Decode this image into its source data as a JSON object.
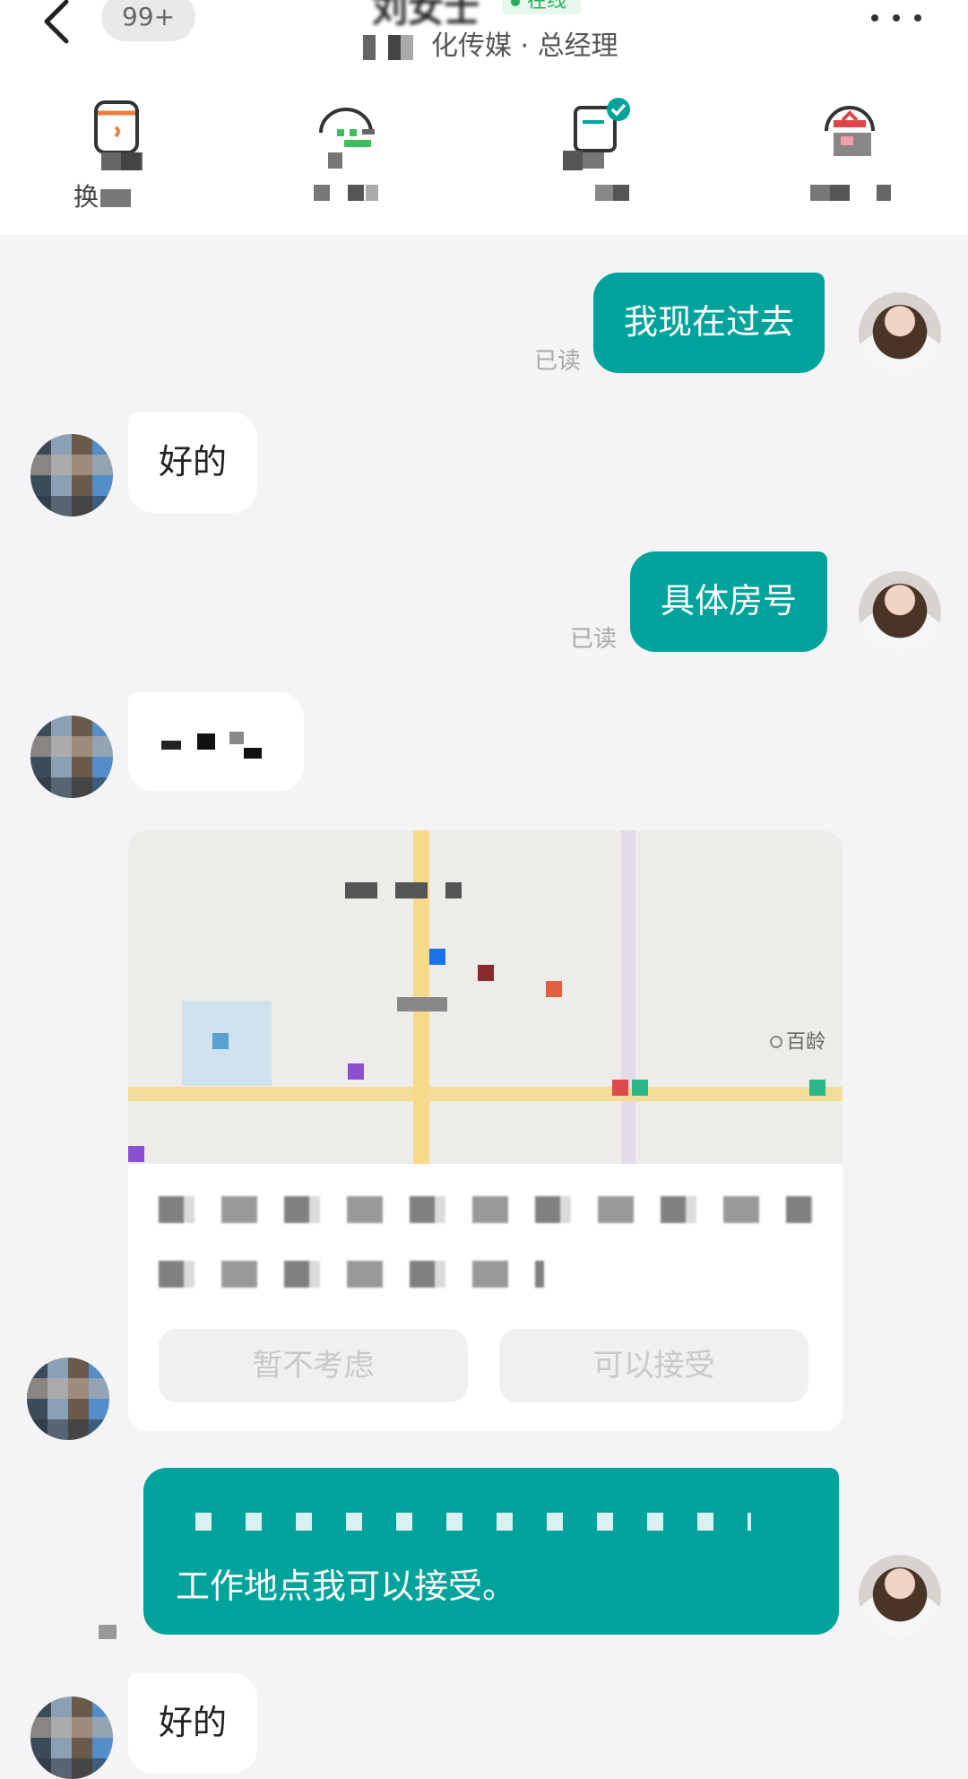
{
  "header": {
    "back_icon": "chevron-left-icon",
    "unread_count": "99+",
    "contact_name": "刘女士",
    "online_status": "在线",
    "company_title": "化传媒 · 总经理",
    "more_icon": "more-dots-icon"
  },
  "actions": [
    {
      "icon": "phone-swap-icon",
      "label": "换"
    },
    {
      "icon": "wechat-swap-icon",
      "label": ""
    },
    {
      "icon": "resume-send-icon",
      "label": ""
    },
    {
      "icon": "gift-icon",
      "label": ""
    }
  ],
  "messages": [
    {
      "from": "me",
      "text": "我现在过去",
      "status": "已读"
    },
    {
      "from": "other",
      "text": "好的"
    },
    {
      "from": "me",
      "text": "具体房号",
      "status": "已读"
    },
    {
      "from": "other",
      "text": ""
    }
  ],
  "location_card": {
    "map_labels": [
      "百龄"
    ],
    "buttons": [
      "暂不考虑",
      "可以接受"
    ]
  },
  "last_reply": "工作地点我可以接受。",
  "partial_message": "好的",
  "colors": {
    "accent": "#00a39b",
    "background": "#f4f4f6",
    "online": "#27b05a"
  }
}
